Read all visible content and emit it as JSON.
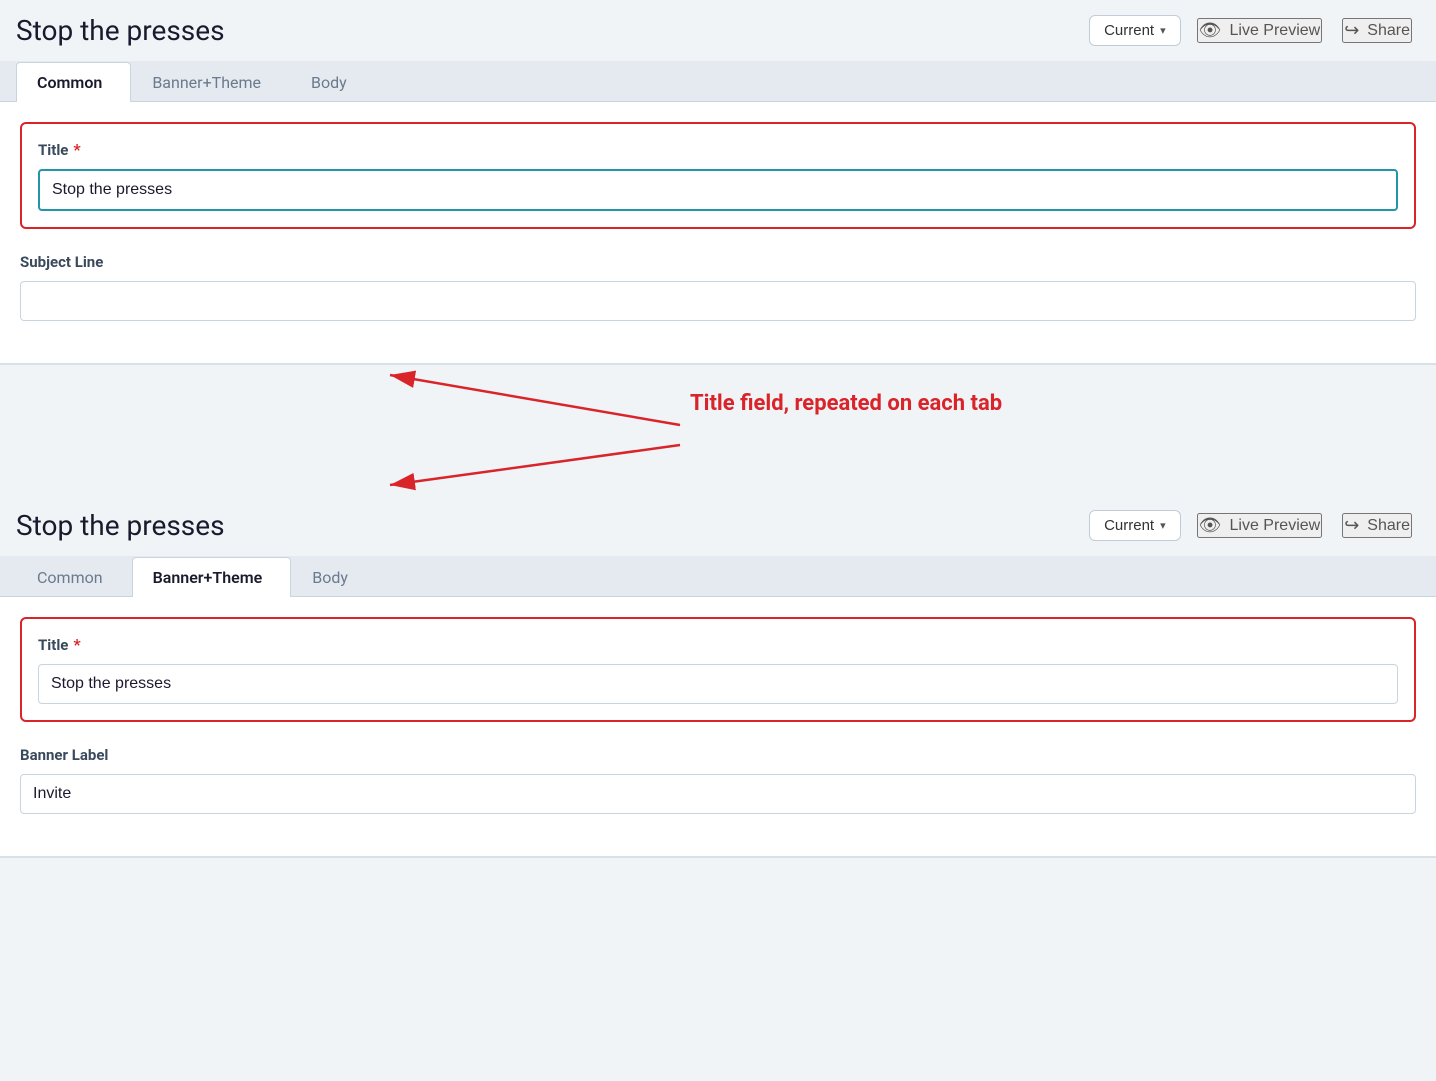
{
  "page_title": "Stop the presses",
  "version_dropdown": {
    "label": "Current",
    "chevron": "▾"
  },
  "header_actions": {
    "live_preview": "Live Preview",
    "share": "Share"
  },
  "top_panel": {
    "tabs": [
      {
        "id": "common",
        "label": "Common",
        "active": true
      },
      {
        "id": "banner_theme",
        "label": "Banner+Theme",
        "active": false
      },
      {
        "id": "body",
        "label": "Body",
        "active": false
      }
    ],
    "fields": {
      "title": {
        "label": "Title",
        "required": true,
        "value": "Stop the presses",
        "focused": true
      },
      "subject_line": {
        "label": "Subject Line",
        "value": ""
      }
    }
  },
  "annotation": {
    "text": "Title field, repeated on each tab",
    "color": "#d9242a"
  },
  "bottom_panel": {
    "tabs": [
      {
        "id": "common",
        "label": "Common",
        "active": false
      },
      {
        "id": "banner_theme",
        "label": "Banner+Theme",
        "active": true
      },
      {
        "id": "body",
        "label": "Body",
        "active": false
      }
    ],
    "fields": {
      "title": {
        "label": "Title",
        "required": true,
        "value": "Stop the presses",
        "focused": false
      },
      "banner_label": {
        "label": "Banner Label",
        "value": "Invite"
      }
    }
  },
  "icons": {
    "eye": "👁",
    "share": "↪"
  }
}
